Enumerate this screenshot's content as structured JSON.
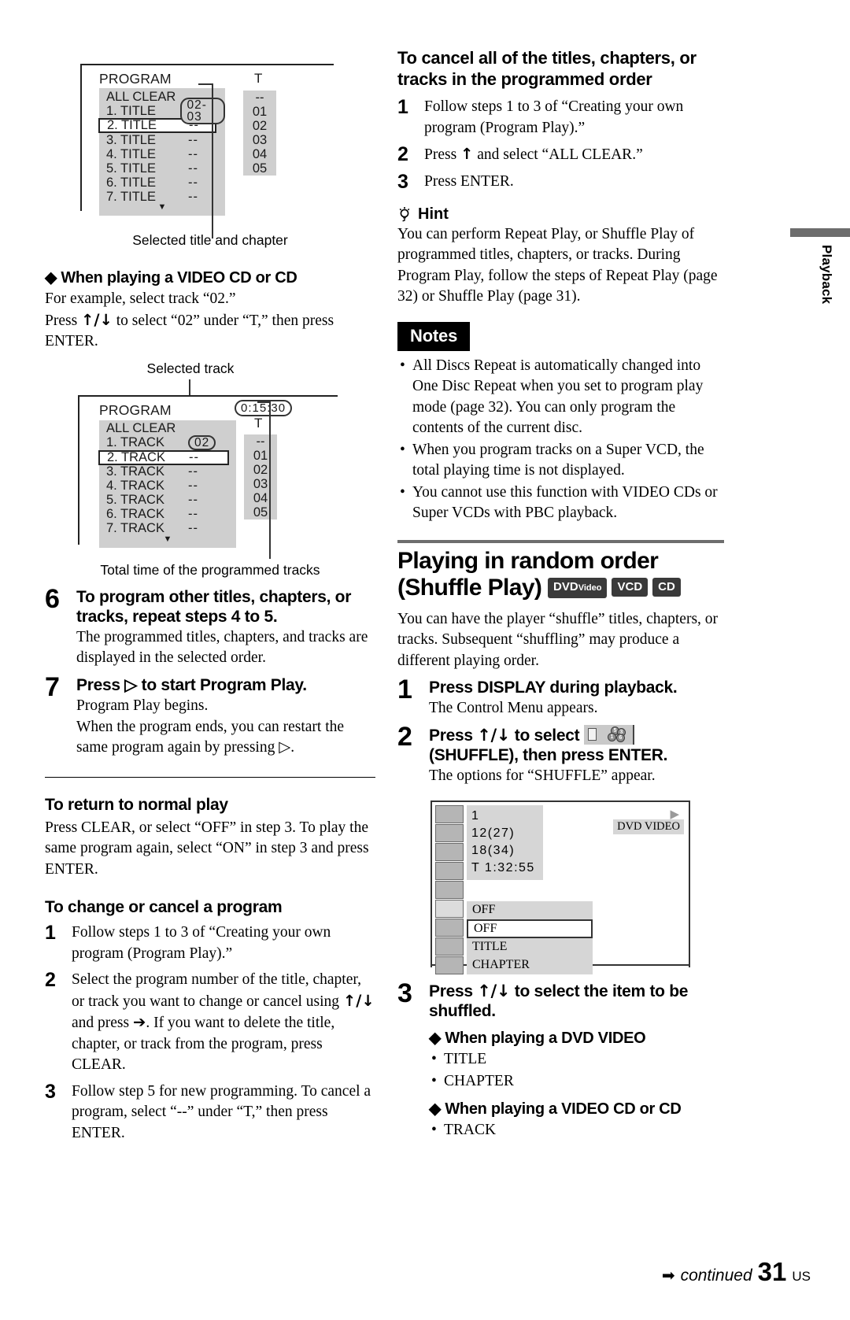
{
  "page": {
    "number": "31",
    "region": "US",
    "continued_label": "continued",
    "side_tab_label": "Playback"
  },
  "left": {
    "program_diagram_1": {
      "title": "PROGRAM",
      "t_header": "T",
      "rows": [
        {
          "label": "ALL CLEAR",
          "value": ""
        },
        {
          "label": "1. TITLE",
          "value": "02-03",
          "highlighted_value": true
        },
        {
          "label": "2. TITLE",
          "value": "--",
          "selected": true
        },
        {
          "label": "3. TITLE",
          "value": "--"
        },
        {
          "label": "4. TITLE",
          "value": "--"
        },
        {
          "label": "5. TITLE",
          "value": "--"
        },
        {
          "label": "6. TITLE",
          "value": "--"
        },
        {
          "label": "7. TITLE",
          "value": "--"
        }
      ],
      "t_values": [
        "--",
        "01",
        "02",
        "03",
        "04",
        "05"
      ],
      "caption": "Selected title and chapter"
    },
    "section_video_cd": {
      "heading": "When playing a VIDEO CD or CD",
      "line1": "For example, select track “02.”",
      "line2_a": "Press ",
      "line2_arrows": "↑/↓",
      "line2_b": " to select “02” under “T,” then press ENTER."
    },
    "program_diagram_2": {
      "caption_top": "Selected track",
      "title": "PROGRAM",
      "time_badge": "0:15:30",
      "t_header": "T",
      "rows": [
        {
          "label": "ALL CLEAR",
          "value": ""
        },
        {
          "label": "1. TRACK",
          "value": "02",
          "highlighted_value": true
        },
        {
          "label": "2. TRACK",
          "value": "--",
          "selected": true
        },
        {
          "label": "3. TRACK",
          "value": "--"
        },
        {
          "label": "4. TRACK",
          "value": "--"
        },
        {
          "label": "5. TRACK",
          "value": "--"
        },
        {
          "label": "6. TRACK",
          "value": "--"
        },
        {
          "label": "7. TRACK",
          "value": "--"
        }
      ],
      "t_values": [
        "--",
        "01",
        "02",
        "03",
        "04",
        "05"
      ],
      "caption_bottom": "Total time of the programmed tracks"
    },
    "step6": {
      "num": "6",
      "title": "To program other titles, chapters, or tracks, repeat steps 4 to 5.",
      "sub": "The programmed titles, chapters, and tracks are displayed in the selected order."
    },
    "step7": {
      "num": "7",
      "title_a": "Press ",
      "title_icon": "▷",
      "title_b": " to start Program Play.",
      "sub1": "Program Play begins.",
      "sub2_a": "When the program ends, you can restart the same program again by pressing ",
      "sub2_icon": "▷",
      "sub2_b": "."
    },
    "return_normal": {
      "heading": "To return to normal play",
      "body": "Press CLEAR, or select “OFF” in step 3. To play the same program again, select “ON” in step 3 and press ENTER."
    },
    "change_cancel": {
      "heading": "To change or cancel a program",
      "steps": [
        {
          "num": "1",
          "text": "Follow steps 1 to 3 of “Creating your own program (Program Play).”"
        },
        {
          "num": "2",
          "text_a": "Select the program number of the title, chapter, or track you want to change or cancel using ",
          "arrows": "↑/↓",
          "text_b": " and press ",
          "arrow_right": "➔",
          "text_c": ". If you want to delete the title, chapter, or track from the program, press CLEAR."
        },
        {
          "num": "3",
          "text": "Follow step 5 for new programming. To cancel a program, select “--” under “T,” then press ENTER."
        }
      ]
    }
  },
  "right": {
    "cancel_all": {
      "heading": "To cancel all of the titles, chapters, or tracks in the programmed order",
      "steps": [
        {
          "num": "1",
          "text": "Follow steps 1 to 3 of “Creating your own program (Program Play).”"
        },
        {
          "num": "2",
          "text_a": "Press ",
          "arrow": "↑",
          "text_b": " and select “ALL CLEAR.”"
        },
        {
          "num": "3",
          "text": "Press ENTER."
        }
      ]
    },
    "hint": {
      "label": "Hint",
      "body": "You can perform Repeat Play, or Shuffle Play of programmed titles, chapters, or tracks. During Program Play, follow the steps of Repeat Play (page 32) or Shuffle Play (page 31)."
    },
    "notes": {
      "label": "Notes",
      "items": [
        "All Discs Repeat is automatically changed into One Disc Repeat when you set to program play mode (page 32). You can only program the contents of the current disc.",
        "When you program tracks on a Super VCD, the total playing time is not displayed.",
        "You cannot use this function with VIDEO CDs or Super VCDs with PBC playback."
      ]
    },
    "shuffle_section": {
      "title": "Playing in random order (Shuffle Play)",
      "badges": [
        {
          "main": "DVD",
          "small": "Video"
        },
        {
          "main": "VCD",
          "small": ""
        },
        {
          "main": "CD",
          "small": ""
        }
      ],
      "intro": "You can have the player “shuffle” titles, chapters, or tracks. Subsequent “shuffling” may produce a different playing order.",
      "step1": {
        "num": "1",
        "title": "Press DISPLAY during playback.",
        "sub": "The Control Menu appears."
      },
      "step2": {
        "num": "2",
        "title_a": "Press ",
        "arrows": "↑/↓",
        "title_b": " to select ",
        "icon_name": "shuffle-icon",
        "title_c": "(SHUFFLE), then press ENTER.",
        "sub": "The options for “SHUFFLE” appear."
      },
      "control_menu": {
        "info_lines": [
          "1",
          "12(27)",
          "18(34)",
          "T   1:32:55"
        ],
        "options": [
          {
            "label": "OFF",
            "selected": false
          },
          {
            "label": "OFF",
            "selected": true
          },
          {
            "label": "TITLE",
            "selected": false
          },
          {
            "label": "CHAPTER",
            "selected": false
          }
        ],
        "disc_label": "DVD VIDEO",
        "play_arrow": "▶"
      },
      "step3": {
        "num": "3",
        "title": "Press ↑/↓ to select the item to be shuffled.",
        "title_a": "Press ",
        "arrows": "↑/↓",
        "title_b": " to select the item to be shuffled.",
        "group_dvd": {
          "heading": "When playing a DVD VIDEO",
          "items": [
            "TITLE",
            "CHAPTER"
          ]
        },
        "group_vcd": {
          "heading": "When playing a VIDEO CD or CD",
          "items": [
            "TRACK"
          ]
        }
      }
    }
  }
}
